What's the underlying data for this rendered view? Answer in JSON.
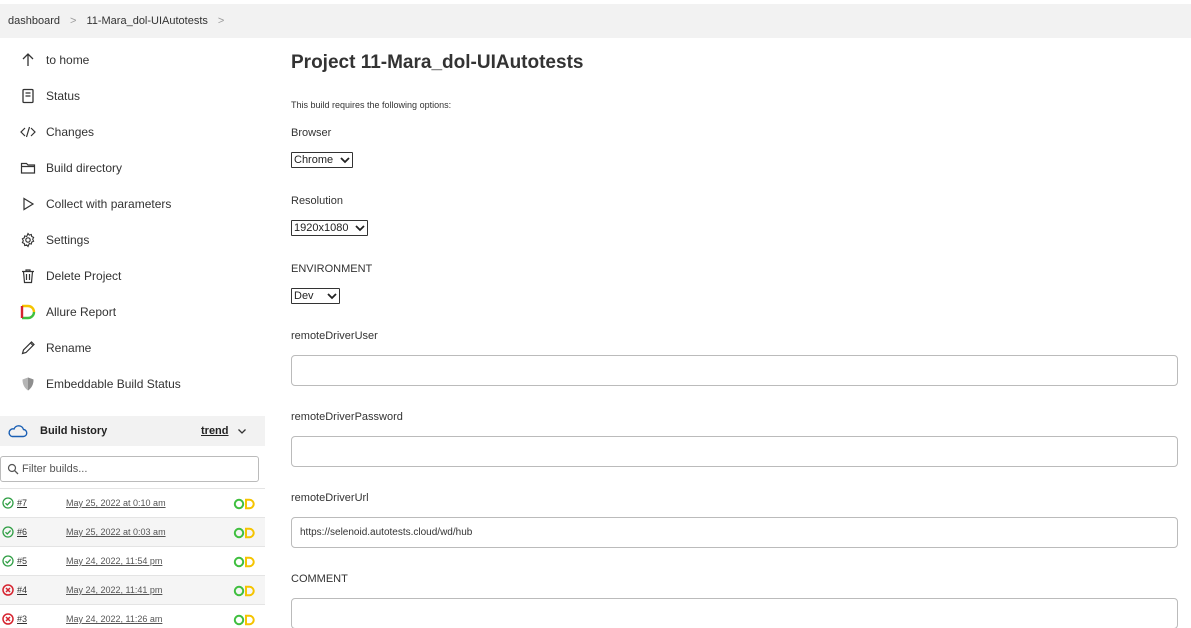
{
  "breadcrumb": {
    "items": [
      "dashboard",
      "11-Mara_dol-UIAutotests"
    ]
  },
  "sidebar": {
    "tasks": [
      {
        "label": "to home",
        "icon": "arrow-up-icon"
      },
      {
        "label": "Status",
        "icon": "document-icon"
      },
      {
        "label": "Changes",
        "icon": "code-icon"
      },
      {
        "label": "Build directory",
        "icon": "folder-icon"
      },
      {
        "label": "Collect with parameters",
        "icon": "play-icon"
      },
      {
        "label": "Settings",
        "icon": "gear-icon"
      },
      {
        "label": "Delete Project",
        "icon": "trash-icon"
      },
      {
        "label": "Allure Report",
        "icon": "allure-icon"
      },
      {
        "label": "Rename",
        "icon": "pencil-icon"
      },
      {
        "label": "Embeddable Build Status",
        "icon": "shield-icon"
      }
    ]
  },
  "build_history": {
    "title": "Build history",
    "trend_label": "trend",
    "filter_placeholder": "Filter builds...",
    "builds": [
      {
        "number": "#7",
        "date": "May 25, 2022 at 0:10 am",
        "status": "success"
      },
      {
        "number": "#6",
        "date": "May 25, 2022 at 0:03 am",
        "status": "success"
      },
      {
        "number": "#5",
        "date": "May 24, 2022, 11:54 pm",
        "status": "success"
      },
      {
        "number": "#4",
        "date": "May 24, 2022, 11:41 pm",
        "status": "failed"
      },
      {
        "number": "#3",
        "date": "May 24, 2022, 11:26 am",
        "status": "failed"
      }
    ]
  },
  "main": {
    "title": "Project 11-Mara_dol-UIAutotests",
    "info": "This build requires the following options:",
    "params": {
      "browser": {
        "label": "Browser",
        "value": "Chrome"
      },
      "resolution": {
        "label": "Resolution",
        "value": "1920x1080"
      },
      "environment": {
        "label": "ENVIRONMENT",
        "value": "Dev"
      },
      "remote_user": {
        "label": "remoteDriverUser",
        "value": ""
      },
      "remote_password": {
        "label": "remoteDriverPassword",
        "value": ""
      },
      "remote_url": {
        "label": "remoteDriverUrl",
        "value": "https://selenoid.autotests.cloud/wd/hub"
      },
      "comment": {
        "label": "COMMENT",
        "value": ""
      }
    }
  },
  "colors": {
    "success": "#2f9e44",
    "failed": "#d6232f",
    "allure_yellow": "#f5c400",
    "allure_green": "#3fbf3f"
  }
}
